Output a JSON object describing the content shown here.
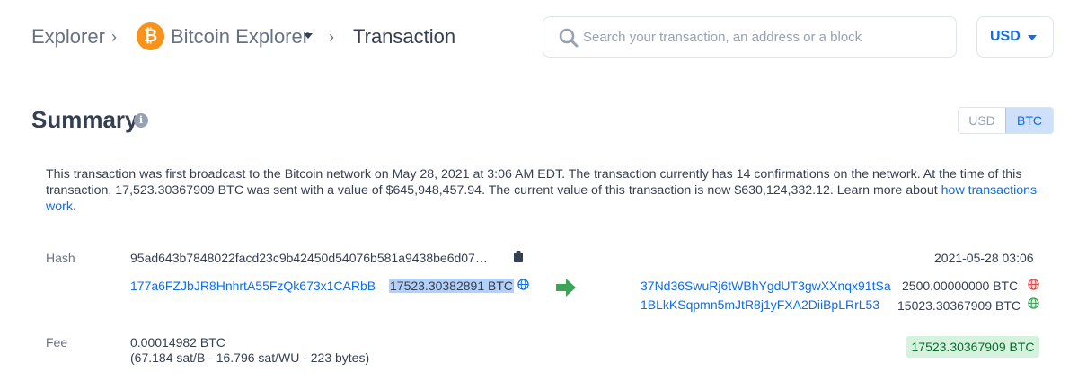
{
  "header": {
    "breadcrumb": {
      "explorer": "Explorer",
      "bitcoin_explorer": "Bitcoin Explorer",
      "transaction": "Transaction"
    },
    "logo_symbol": "₿",
    "search": {
      "placeholder": "Search your transaction, an address or a block",
      "value": ""
    },
    "currency": {
      "selected": "USD"
    }
  },
  "summary": {
    "title": "Summary",
    "toggle": {
      "usd_label": "USD",
      "btc_label": "BTC",
      "active": "BTC"
    },
    "description_text": "This transaction was first broadcast to the Bitcoin network on May 28, 2021 at 3:06 AM EDT.  The transaction currently has 14 confirmations on the network.  At the time of this transaction, 17,523.30367909 BTC was sent with a value of $645,948,457.94. The current value of this transaction is now $630,124,332.12.  Learn more about ",
    "description_link": "how transactions work",
    "description_end": "."
  },
  "transaction": {
    "hash_label": "Hash",
    "hash": "95ad643b7848022facd23c9b42450d54076b581a9438be6d07…",
    "timestamp": "2021-05-28 03:06",
    "inputs": [
      {
        "address": "177a6FZJbJR8HnhrtA55FzQk673x1CARbB",
        "amount": "17523.30382891 BTC"
      }
    ],
    "outputs": [
      {
        "address": "37Nd36SwuRj6tWBhYgdUT3gwXXnqx91tSa",
        "amount": "2500.00000000 BTC",
        "status": "unspent"
      },
      {
        "address": "1BLkKSqpmn5mJtR8j1yFXA2DiiBpLRrL53",
        "amount": "15023.30367909 BTC",
        "status": "spent"
      }
    ],
    "fee_label": "Fee",
    "fee_btc": "0.00014982 BTC",
    "fee_detail": "(67.184 sat/B - 16.796 sat/WU - 223 bytes)",
    "total_output": "17523.30367909 BTC"
  },
  "colors": {
    "link": "#0c6cf2",
    "bitcoin_orange": "#f7931a",
    "arrow_green": "#3aa557",
    "globe_red": "#e04848",
    "globe_green": "#3aa557",
    "globe_blue": "#0c6cf2",
    "total_badge_bg": "#d4f2dc"
  }
}
